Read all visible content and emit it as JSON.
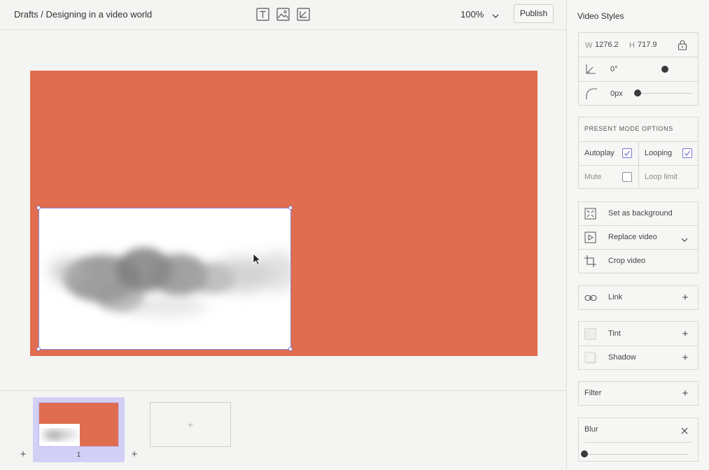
{
  "topbar": {
    "breadcrumb": "Drafts / Designing in a video world",
    "tools": [
      "text-tool-icon",
      "image-tool-icon",
      "shape-tool-icon"
    ],
    "zoom": "100%",
    "publish_label": "Publish"
  },
  "canvas": {
    "background_color": "#e06d4f",
    "video_bg": "#ffffff"
  },
  "filmstrip": {
    "slides": [
      {
        "number": "1"
      }
    ],
    "empty_slide_plus": "+",
    "add_before": "+",
    "add_after": "+"
  },
  "panel": {
    "title": "Video Styles",
    "size": {
      "w_label": "W",
      "w_value": "1276.2",
      "h_label": "H",
      "h_value": "717.9"
    },
    "rotation": "0°",
    "radius": "0px",
    "present_mode": {
      "heading": "PRESENT MODE OPTIONS",
      "autoplay": "Autoplay",
      "looping": "Looping",
      "mute": "Mute",
      "loop_limit": "Loop limit",
      "autoplay_checked": true,
      "looping_checked": true,
      "mute_checked": false
    },
    "actions": {
      "set_background": "Set as background",
      "replace_video": "Replace video",
      "crop_video": "Crop video"
    },
    "link": "Link",
    "tint": "Tint",
    "shadow": "Shadow",
    "filter": "Filter",
    "blur": "Blur",
    "accent": "#7a76d6"
  }
}
